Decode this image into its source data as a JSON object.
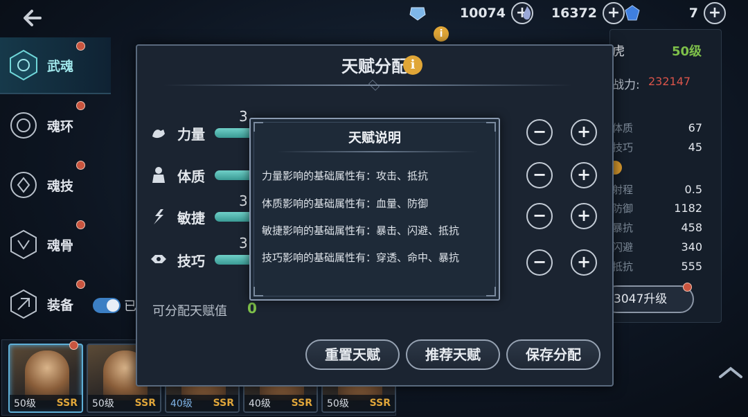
{
  "topbar": {
    "back_icon": "back-arrow-icon",
    "resources": [
      {
        "icon": "diamond-crystal-icon",
        "value": "10074",
        "color": "#7fb7e8"
      },
      {
        "icon": "soul-flame-icon",
        "value": "16372",
        "color": "#9aa8d8"
      },
      {
        "icon": "blue-gem-icon",
        "value": "7",
        "color": "#3f7fe0"
      }
    ]
  },
  "sidebar": {
    "items": [
      {
        "label": "武魂",
        "icon": "martial-soul-icon",
        "active": true
      },
      {
        "label": "魂环",
        "icon": "soul-ring-icon",
        "active": false
      },
      {
        "label": "魂技",
        "icon": "soul-skill-icon",
        "active": false
      },
      {
        "label": "魂骨",
        "icon": "soul-bone-icon",
        "active": false
      },
      {
        "label": "装备",
        "icon": "equipment-icon",
        "active": false
      }
    ],
    "toggle_label": "已"
  },
  "right_panel": {
    "name_fragment": "虎",
    "level": "50级",
    "power_label": "战力:",
    "power_value": "232147",
    "stats": [
      {
        "k": "体质",
        "v": "67"
      },
      {
        "k": "技巧",
        "v": "45"
      },
      {
        "k": "射程",
        "v": "0.5"
      },
      {
        "k": "防御",
        "v": "1182"
      },
      {
        "k": "暴抗",
        "v": "458"
      },
      {
        "k": "闪避",
        "v": "340"
      },
      {
        "k": "抵抗",
        "v": "555"
      }
    ],
    "upgrade_label": "3047升级"
  },
  "dialog": {
    "title": "天赋分配",
    "info_glyph": "i",
    "attributes": [
      {
        "label": "力量",
        "icon": "strength-icon",
        "value": "3"
      },
      {
        "label": "体质",
        "icon": "constitution-icon",
        "value": ""
      },
      {
        "label": "敏捷",
        "icon": "agility-icon",
        "value": "3"
      },
      {
        "label": "技巧",
        "icon": "technique-icon",
        "value": "3"
      }
    ],
    "minus": "−",
    "plus": "+",
    "available_label": "可分配天赋值",
    "available_value": "0",
    "buttons": {
      "reset": "重置天赋",
      "recommend": "推荐天赋",
      "save": "保存分配"
    }
  },
  "tooltip": {
    "title": "天赋说明",
    "lines": [
      "力量影响的基础属性有：攻击、抵抗",
      "体质影响的基础属性有：血量、防御",
      "敏捷影响的基础属性有：暴击、闪避、抵抗",
      "技巧影响的基础属性有：穿透、命中、暴抗"
    ]
  },
  "heroes": [
    {
      "level": "50级",
      "rarity": "SSR",
      "selected": true
    },
    {
      "level": "50级",
      "rarity": "SSR",
      "selected": false
    },
    {
      "level": "40级",
      "rarity": "SSR",
      "selected": false
    },
    {
      "level": "40级",
      "rarity": "SSR",
      "selected": false
    },
    {
      "level": "50级",
      "rarity": "SSR",
      "selected": false
    }
  ]
}
